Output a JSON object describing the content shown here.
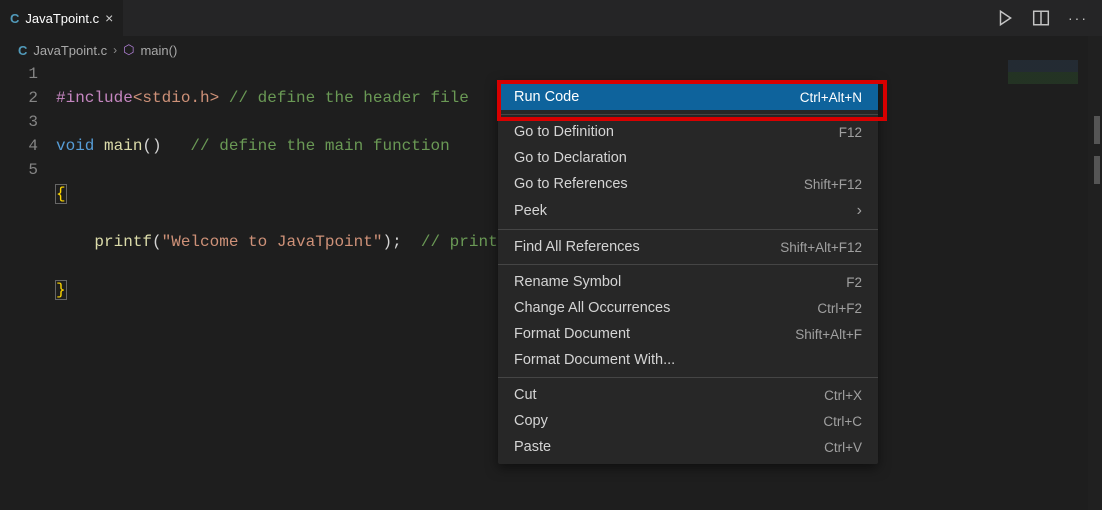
{
  "tab": {
    "icon": "C",
    "label": "JavaTpoint.c"
  },
  "breadcrumb": {
    "file_icon": "C",
    "file": "JavaTpoint.c",
    "symbol_icon": "⬡",
    "symbol": "main()"
  },
  "code": {
    "lines": [
      {
        "n": "1",
        "macro": "#include",
        "inc": "<stdio.h>",
        "comment": "// define the header file"
      },
      {
        "n": "2",
        "kw1": "void",
        "fn": "main",
        "paren": "()",
        "comment": "   // define the main function"
      },
      {
        "n": "3",
        "brace": "{"
      },
      {
        "n": "4",
        "indent": "    ",
        "fn": "printf",
        "pre": "(",
        "str": "\"Welcome to JavaTpoint\"",
        "post": ");",
        "comment": "  // print"
      },
      {
        "n": "5",
        "brace": "}"
      }
    ]
  },
  "context_menu": {
    "groups": [
      [
        {
          "label": "Run Code",
          "shortcut": "Ctrl+Alt+N",
          "selected": true
        }
      ],
      [
        {
          "label": "Go to Definition",
          "shortcut": "F12"
        },
        {
          "label": "Go to Declaration",
          "shortcut": ""
        },
        {
          "label": "Go to References",
          "shortcut": "Shift+F12"
        },
        {
          "label": "Peek",
          "submenu": true
        }
      ],
      [
        {
          "label": "Find All References",
          "shortcut": "Shift+Alt+F12"
        }
      ],
      [
        {
          "label": "Rename Symbol",
          "shortcut": "F2"
        },
        {
          "label": "Change All Occurrences",
          "shortcut": "Ctrl+F2"
        },
        {
          "label": "Format Document",
          "shortcut": "Shift+Alt+F"
        },
        {
          "label": "Format Document With...",
          "shortcut": ""
        }
      ],
      [
        {
          "label": "Cut",
          "shortcut": "Ctrl+X"
        },
        {
          "label": "Copy",
          "shortcut": "Ctrl+C"
        },
        {
          "label": "Paste",
          "shortcut": "Ctrl+V"
        }
      ]
    ]
  }
}
